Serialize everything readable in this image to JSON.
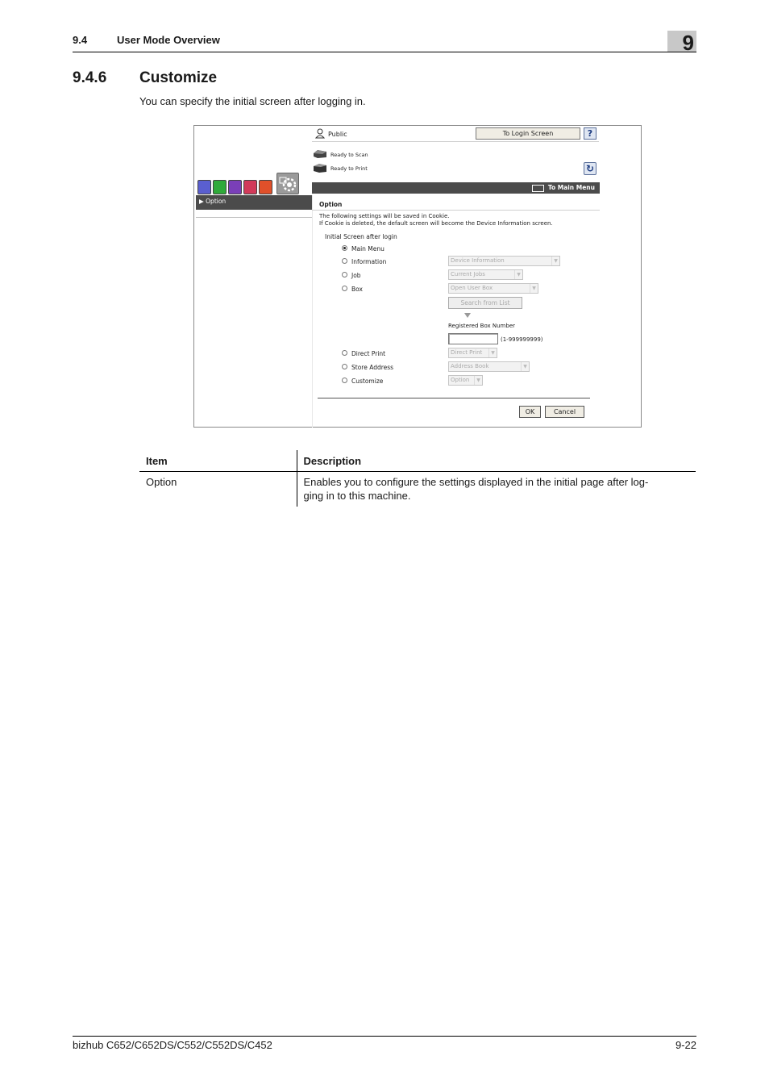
{
  "header": {
    "section_number": "9.4",
    "section_title": "User Mode Overview",
    "chapter": "9"
  },
  "section": {
    "number": "9.4.6",
    "title": "Customize"
  },
  "intro": "You can specify the initial screen after logging in.",
  "screen": {
    "user_label": "Public",
    "login_button": "To Login Screen",
    "help_button": "?",
    "scanner_status": "Ready to Scan",
    "printer_status": "Ready to Print",
    "to_main_menu": "To Main Menu",
    "sidebar_item": "Option",
    "panel_title": "Option",
    "note_line1": "The following settings will be saved in Cookie.",
    "note_line2": "If Cookie is deleted, the default screen will become the Device Information screen.",
    "group_label": "Initial Screen after login",
    "options": [
      {
        "label": "Main Menu",
        "selected": true
      },
      {
        "label": "Information",
        "select_value": "Device Information"
      },
      {
        "label": "Job",
        "select_value": "Current Jobs"
      },
      {
        "label": "Box",
        "select_value": "Open User Box"
      },
      {
        "label": "Direct Print",
        "select_value": "Direct Print"
      },
      {
        "label": "Store Address",
        "select_value": "Address Book"
      },
      {
        "label": "Customize",
        "select_value": "Option"
      }
    ],
    "search_button": "Search from List",
    "registered_box_label": "Registered Box Number",
    "registered_box_range": "(1-999999999)",
    "ok_button": "OK",
    "cancel_button": "Cancel",
    "tab_colors": [
      "#5a5fd0",
      "#2faa3a",
      "#7a3fb8",
      "#d23a5a",
      "#e0502a"
    ]
  },
  "table": {
    "headers": [
      "Item",
      "Description"
    ],
    "rows": [
      {
        "item": "Option",
        "description_line1": "Enables you to configure the settings displayed in the initial page after log-",
        "description_line2": "ging in to this machine."
      }
    ]
  },
  "footer": {
    "model": "bizhub C652/C652DS/C552/C552DS/C452",
    "page": "9-22"
  }
}
